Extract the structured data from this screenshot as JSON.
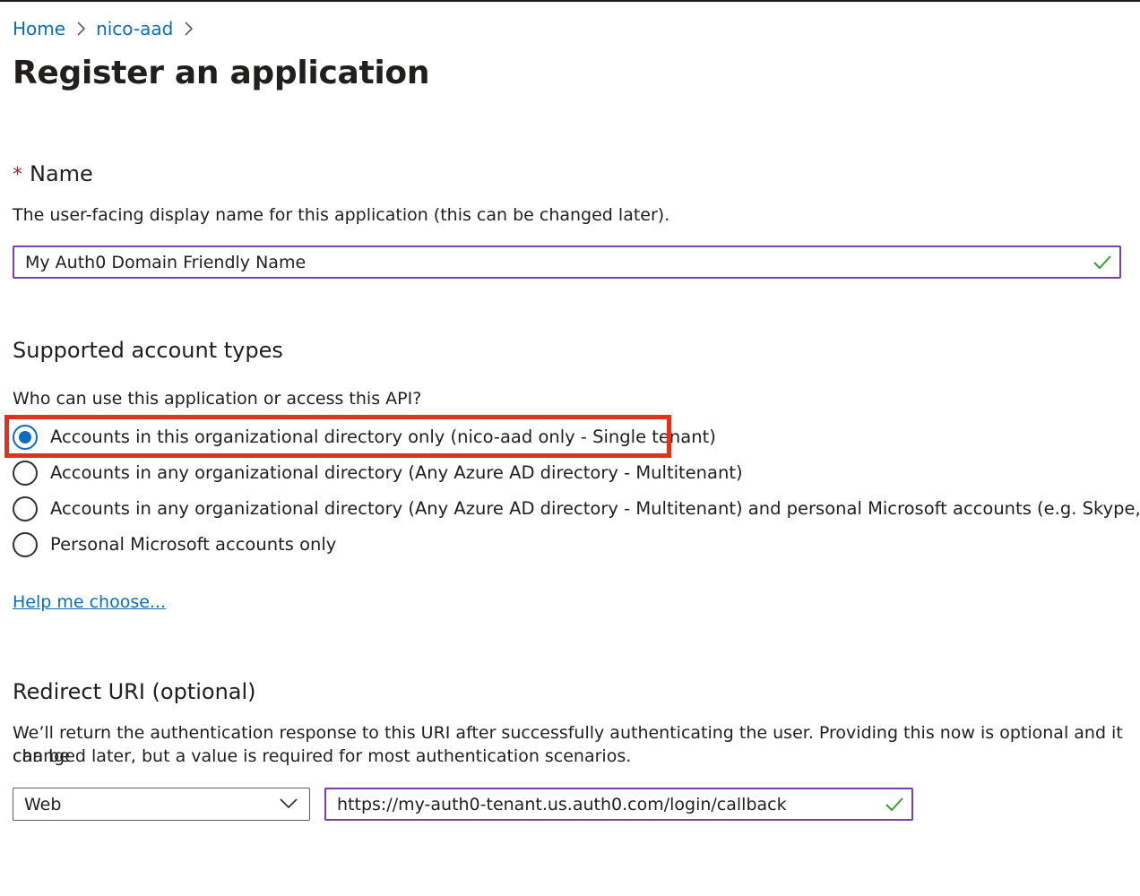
{
  "breadcrumb": {
    "items": [
      "Home",
      "nico-aad"
    ]
  },
  "page": {
    "title": "Register an application"
  },
  "name_section": {
    "required_mark": "*",
    "label": "Name",
    "description": "The user-facing display name for this application (this can be changed later).",
    "value": "My Auth0 Domain Friendly Name"
  },
  "account_types": {
    "title": "Supported account types",
    "question": "Who can use this application or access this API?",
    "options": [
      {
        "label": "Accounts in this organizational directory only (nico-aad only - Single tenant)",
        "selected": true
      },
      {
        "label": "Accounts in any organizational directory (Any Azure AD directory - Multitenant)",
        "selected": false
      },
      {
        "label": "Accounts in any organizational directory (Any Azure AD directory - Multitenant) and personal Microsoft accounts (e.g. Skype, Xbox)",
        "selected": false
      },
      {
        "label": "Personal Microsoft accounts only",
        "selected": false
      }
    ],
    "help_link": "Help me choose..."
  },
  "redirect": {
    "title": "Redirect URI (optional)",
    "description_line1": "We’ll return the authentication response to this URI after successfully authenticating the user. Providing this now is optional and it can be",
    "description_line2": "changed later, but a value is required for most authentication scenarios.",
    "platform": "Web",
    "uri": "https://my-auth0-tenant.us.auth0.com/login/callback"
  },
  "colors": {
    "link": "#0f6cbd",
    "valid_border": "#7c3fa5",
    "valid_check": "#3aa033",
    "highlight": "#e0321c",
    "required": "#a4262c"
  }
}
